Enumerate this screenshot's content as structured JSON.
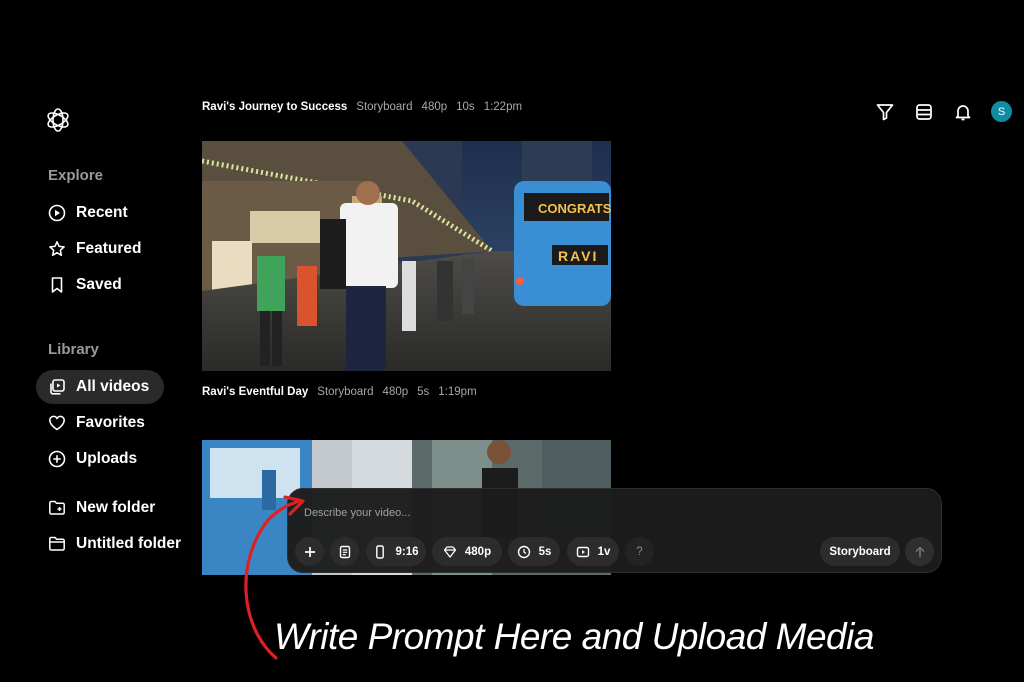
{
  "sidebar": {
    "explore_heading": "Explore",
    "explore_items": [
      {
        "label": "Recent",
        "icon": "play-circle-icon"
      },
      {
        "label": "Featured",
        "icon": "star-icon"
      },
      {
        "label": "Saved",
        "icon": "bookmark-icon"
      }
    ],
    "library_heading": "Library",
    "library_items": [
      {
        "label": "All videos",
        "icon": "videos-icon",
        "active": true
      },
      {
        "label": "Favorites",
        "icon": "heart-icon"
      },
      {
        "label": "Uploads",
        "icon": "plus-circle-icon"
      }
    ],
    "folder_items": [
      {
        "label": "New folder",
        "icon": "folder-plus-icon"
      },
      {
        "label": "Untitled folder",
        "icon": "folder-icon"
      }
    ]
  },
  "videos": [
    {
      "title": "Ravi's Journey to Success",
      "type": "Storyboard",
      "resolution": "480p",
      "duration": "10s",
      "time": "1:22pm",
      "bus_sign": "CONGRATS",
      "bus_name": "RAVI"
    },
    {
      "title": "Ravi's Eventful Day",
      "type": "Storyboard",
      "resolution": "480p",
      "duration": "5s",
      "time": "1:19pm"
    }
  ],
  "topbar": {
    "icons": [
      "filter-icon",
      "layout-icon",
      "bell-icon"
    ],
    "avatar_initial": "S"
  },
  "composer": {
    "placeholder": "Describe your video...",
    "aspect": "9:16",
    "resolution": "480p",
    "duration": "5s",
    "variations": "1v",
    "help": "?",
    "mode": "Storyboard"
  },
  "annotation": {
    "text": "Write Prompt Here and Upload Media",
    "color": "#e02020"
  },
  "colors": {
    "background": "#000000",
    "avatar": "#0f8ea3",
    "active_nav": "#2a2a2a"
  }
}
